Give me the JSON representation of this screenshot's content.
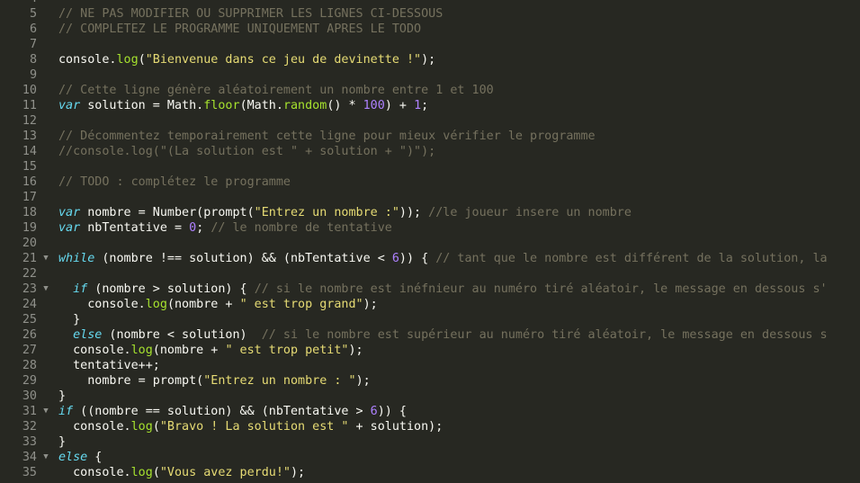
{
  "editor": {
    "fold_glyph": "▼",
    "colors": {
      "background": "#272822",
      "gutter": "#8f908a",
      "plain": "#f8f8f2",
      "comment": "#75715e",
      "keyword": "#66d9ef",
      "string": "#e6db74",
      "number": "#ae81ff",
      "method": "#a6e22e"
    },
    "lines": [
      {
        "n": "4",
        "tokens": []
      },
      {
        "n": "5",
        "tokens": [
          {
            "t": "comment",
            "v": "// NE PAS MODIFIER OU SUPPRIMER LES LIGNES CI-DESSOUS"
          }
        ]
      },
      {
        "n": "6",
        "tokens": [
          {
            "t": "comment",
            "v": "// COMPLETEZ LE PROGRAMME UNIQUEMENT APRES LE TODO"
          }
        ]
      },
      {
        "n": "7",
        "tokens": []
      },
      {
        "n": "8",
        "tokens": [
          {
            "t": "plain",
            "v": "console."
          },
          {
            "t": "method",
            "v": "log"
          },
          {
            "t": "plain",
            "v": "("
          },
          {
            "t": "string",
            "v": "\"Bienvenue dans ce jeu de devinette !\""
          },
          {
            "t": "plain",
            "v": ");"
          }
        ]
      },
      {
        "n": "9",
        "tokens": []
      },
      {
        "n": "10",
        "tokens": [
          {
            "t": "comment",
            "v": "// Cette ligne génère aléatoirement un nombre entre 1 et 100"
          }
        ]
      },
      {
        "n": "11",
        "tokens": [
          {
            "t": "keyword",
            "v": "var"
          },
          {
            "t": "plain",
            "v": " solution = Math."
          },
          {
            "t": "method",
            "v": "floor"
          },
          {
            "t": "plain",
            "v": "(Math."
          },
          {
            "t": "method",
            "v": "random"
          },
          {
            "t": "plain",
            "v": "() * "
          },
          {
            "t": "number",
            "v": "100"
          },
          {
            "t": "plain",
            "v": ") + "
          },
          {
            "t": "number",
            "v": "1"
          },
          {
            "t": "plain",
            "v": ";"
          }
        ]
      },
      {
        "n": "12",
        "tokens": []
      },
      {
        "n": "13",
        "tokens": [
          {
            "t": "comment",
            "v": "// Décommentez temporairement cette ligne pour mieux vérifier le programme"
          }
        ]
      },
      {
        "n": "14",
        "tokens": [
          {
            "t": "comment",
            "v": "//console.log(\"(La solution est \" + solution + \")\");"
          }
        ]
      },
      {
        "n": "15",
        "tokens": []
      },
      {
        "n": "16",
        "tokens": [
          {
            "t": "comment",
            "v": "// TODO : complétez le programme"
          }
        ]
      },
      {
        "n": "17",
        "tokens": []
      },
      {
        "n": "18",
        "tokens": [
          {
            "t": "keyword",
            "v": "var"
          },
          {
            "t": "plain",
            "v": " nombre = Number(prompt("
          },
          {
            "t": "string",
            "v": "\"Entrez un nombre :\""
          },
          {
            "t": "plain",
            "v": ")); "
          },
          {
            "t": "comment",
            "v": "//le joueur insere un nombre"
          }
        ]
      },
      {
        "n": "19",
        "tokens": [
          {
            "t": "keyword",
            "v": "var"
          },
          {
            "t": "plain",
            "v": " nbTentative = "
          },
          {
            "t": "number",
            "v": "0"
          },
          {
            "t": "plain",
            "v": "; "
          },
          {
            "t": "comment",
            "v": "// le nombre de tentative"
          }
        ]
      },
      {
        "n": "20",
        "tokens": []
      },
      {
        "n": "21",
        "fold": true,
        "tokens": [
          {
            "t": "keyword",
            "v": "while"
          },
          {
            "t": "plain",
            "v": " (nombre !== solution) && (nbTentative < "
          },
          {
            "t": "number",
            "v": "6"
          },
          {
            "t": "plain",
            "v": ")) { "
          },
          {
            "t": "comment",
            "v": "// tant que le nombre est différent de la solution, la"
          }
        ]
      },
      {
        "n": "22",
        "tokens": []
      },
      {
        "n": "23",
        "fold": true,
        "tokens": [
          {
            "t": "plain",
            "v": "  "
          },
          {
            "t": "keyword",
            "v": "if"
          },
          {
            "t": "plain",
            "v": " (nombre > solution) { "
          },
          {
            "t": "comment",
            "v": "// si le nombre est inéfnieur au numéro tiré aléatoir, le message en dessous s'"
          }
        ]
      },
      {
        "n": "24",
        "tokens": [
          {
            "t": "plain",
            "v": "    console."
          },
          {
            "t": "method",
            "v": "log"
          },
          {
            "t": "plain",
            "v": "(nombre + "
          },
          {
            "t": "string",
            "v": "\" est trop grand\""
          },
          {
            "t": "plain",
            "v": ");"
          }
        ]
      },
      {
        "n": "25",
        "tokens": [
          {
            "t": "plain",
            "v": "  }"
          }
        ]
      },
      {
        "n": "26",
        "tokens": [
          {
            "t": "plain",
            "v": "  "
          },
          {
            "t": "keyword",
            "v": "else"
          },
          {
            "t": "plain",
            "v": " (nombre < solution)  "
          },
          {
            "t": "comment",
            "v": "// si le nombre est supérieur au numéro tiré aléatoir, le message en dessous s"
          }
        ]
      },
      {
        "n": "27",
        "tokens": [
          {
            "t": "plain",
            "v": "  console."
          },
          {
            "t": "method",
            "v": "log"
          },
          {
            "t": "plain",
            "v": "(nombre + "
          },
          {
            "t": "string",
            "v": "\" est trop petit\""
          },
          {
            "t": "plain",
            "v": ");"
          }
        ]
      },
      {
        "n": "28",
        "tokens": [
          {
            "t": "plain",
            "v": "  tentative++;"
          }
        ]
      },
      {
        "n": "29",
        "tokens": [
          {
            "t": "plain",
            "v": "    nombre = prompt("
          },
          {
            "t": "string",
            "v": "\"Entrez un nombre : \""
          },
          {
            "t": "plain",
            "v": ");"
          }
        ]
      },
      {
        "n": "30",
        "tokens": [
          {
            "t": "plain",
            "v": "}"
          }
        ]
      },
      {
        "n": "31",
        "fold": true,
        "tokens": [
          {
            "t": "keyword",
            "v": "if"
          },
          {
            "t": "plain",
            "v": " ((nombre == solution) && (nbTentative > "
          },
          {
            "t": "number",
            "v": "6"
          },
          {
            "t": "plain",
            "v": ")) {"
          }
        ]
      },
      {
        "n": "32",
        "tokens": [
          {
            "t": "plain",
            "v": "  console."
          },
          {
            "t": "method",
            "v": "log"
          },
          {
            "t": "plain",
            "v": "("
          },
          {
            "t": "string",
            "v": "\"Bravo ! La solution est \""
          },
          {
            "t": "plain",
            "v": " + solution);"
          }
        ]
      },
      {
        "n": "33",
        "tokens": [
          {
            "t": "plain",
            "v": "}"
          }
        ]
      },
      {
        "n": "34",
        "fold": true,
        "tokens": [
          {
            "t": "keyword",
            "v": "else"
          },
          {
            "t": "plain",
            "v": " {"
          }
        ]
      },
      {
        "n": "35",
        "tokens": [
          {
            "t": "plain",
            "v": "  console."
          },
          {
            "t": "method",
            "v": "log"
          },
          {
            "t": "plain",
            "v": "("
          },
          {
            "t": "string",
            "v": "\"Vous avez perdu!\""
          },
          {
            "t": "plain",
            "v": ");"
          }
        ]
      }
    ]
  }
}
